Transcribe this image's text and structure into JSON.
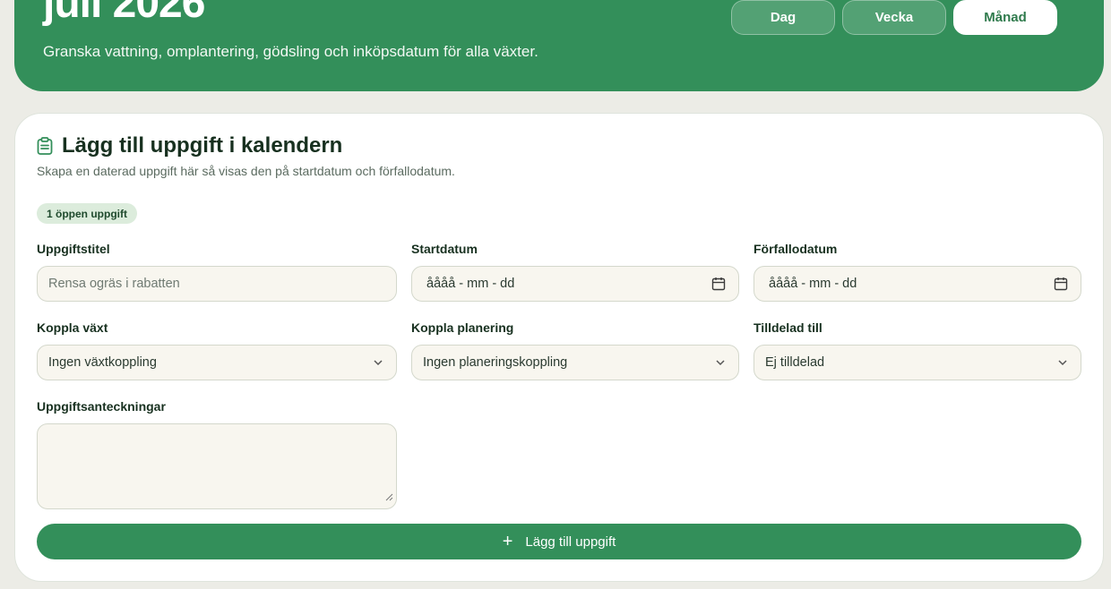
{
  "hero": {
    "title": "juli 2026",
    "subtitle": "Granska vattning, omplantering, gödsling och inköpsdatum för alla växter.",
    "views": [
      "Dag",
      "Vecka",
      "Månad"
    ],
    "active_view": "Månad"
  },
  "form": {
    "title": "Lägg till uppgift i kalendern",
    "icon": "clipboard-icon",
    "subtitle": "Skapa en daterad uppgift här så visas den på startdatum och förfallodatum.",
    "badge": "1 öppen uppgift",
    "fields": {
      "title": {
        "label": "Uppgiftstitel",
        "placeholder": "Rensa ogräs i rabatten",
        "value": ""
      },
      "start": {
        "label": "Startdatum",
        "value": "åååå - mm - dd"
      },
      "due": {
        "label": "Förfallodatum",
        "value": "åååå - mm - dd"
      },
      "plant": {
        "label": "Koppla växt",
        "value": "Ingen växtkoppling"
      },
      "plan": {
        "label": "Koppla planering",
        "value": "Ingen planeringskoppling"
      },
      "assignee": {
        "label": "Tilldelad till",
        "value": "Ej tilldelad"
      },
      "notes": {
        "label": "Uppgiftsanteckningar",
        "value": ""
      }
    },
    "submit_label": "Lägg till uppgift"
  },
  "colors": {
    "primary": "#338f5a",
    "page_bg": "#ecece6",
    "field_bg": "#f8f6ef",
    "badge_bg": "#dcecdc"
  }
}
